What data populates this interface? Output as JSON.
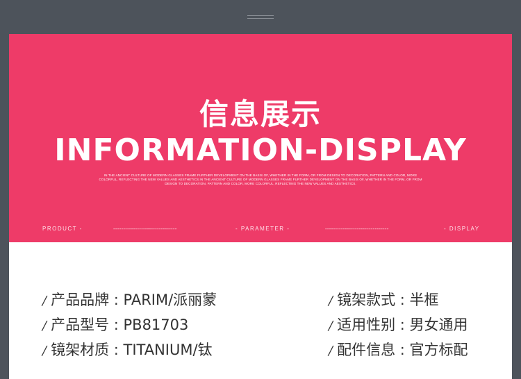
{
  "header": {
    "title_cn": "信息展示",
    "title_en": "INFORMATION-DISPLAY",
    "description": [
      "IN THE ANCIENT CULTURE OF MODERN GLASSES FRAME FURTHER DEVELOPMENT ON THE BASIS OF, WHETHER IN THE FORM, OR FROM DESIGN TO DECORATION, PATTERN AND COLOR, MORE",
      "COLORFUL, REFLECTING THE NEW VALUES AND AESTHETICS.IN THE ANCIENT CULTURE OF MODERN GLASSES FRAME FURTHER DEVELOPMENT ON THE BASIS OF, WHETHER IN THE FORM, OR FROM",
      "DESIGN TO DECORATION, PATTERN AND COLOR, MORE COLORFUL, REFLECTING THE NEW VALUES AND AESTHETICS."
    ],
    "nav": {
      "product": "PRODUCT -",
      "parameter": "- PARAMETER -",
      "display": "- DISPLAY",
      "dash_left": "--------------------------------",
      "dash_right": "--------------------------------"
    }
  },
  "specs": {
    "slash": "/",
    "brand": "产品品牌 : PARIM/派丽蒙",
    "model": "产品型号 : PB81703",
    "material": "镜架材质 : TITANIUM/钛",
    "style": "镜架款式 : 半框",
    "gender": "适用性别 : 男女通用",
    "accessories": "配件信息 : 官方标配"
  },
  "colors": {
    "background": "#4d535b",
    "banner": "#ee3b68",
    "panel": "#ffffff",
    "text": "#333333"
  }
}
